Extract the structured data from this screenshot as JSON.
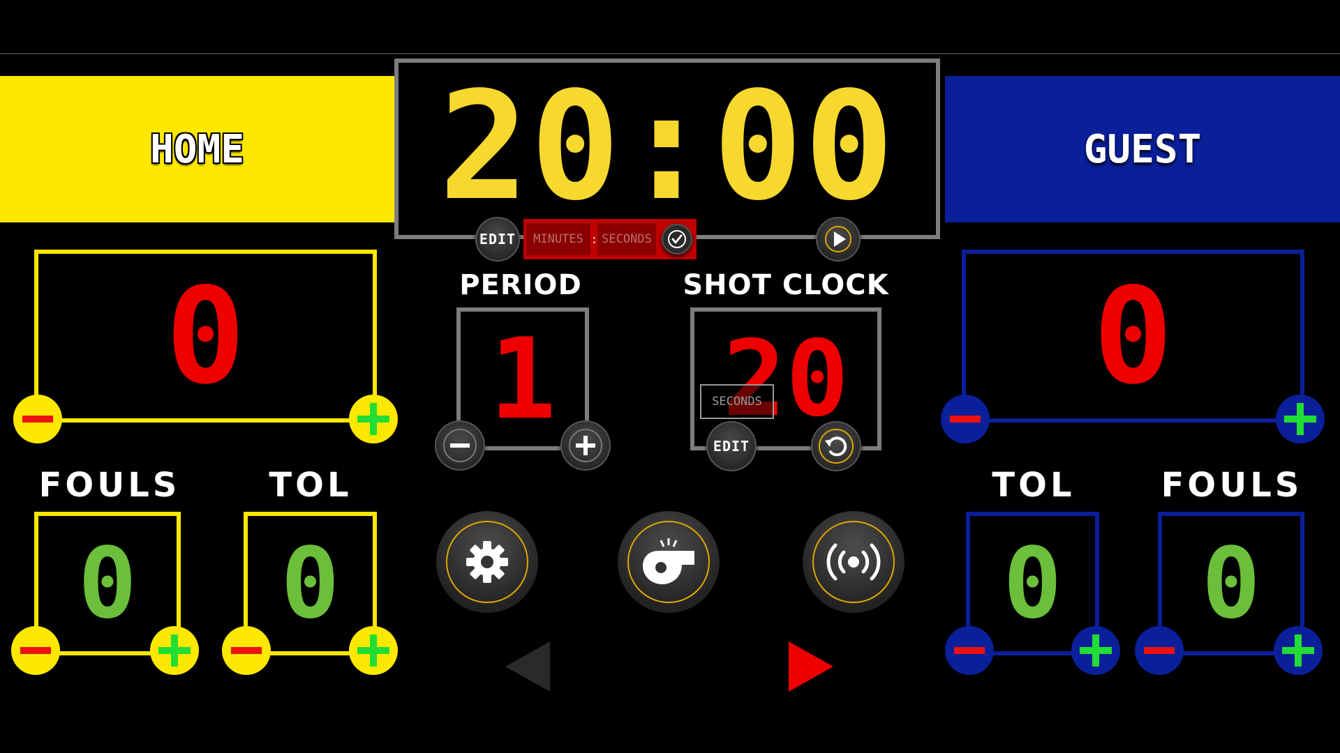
{
  "home": {
    "name": "HOME",
    "score": "0",
    "fouls_label": "FOULS",
    "fouls": "0",
    "tol_label": "TOL",
    "tol": "0"
  },
  "guest": {
    "name": "GUEST",
    "score": "0",
    "fouls_label": "FOULS",
    "fouls": "0",
    "tol_label": "TOL",
    "tol": "0"
  },
  "game_clock": {
    "time": "20:00",
    "edit_label": "EDIT",
    "minutes_placeholder": "MINUTES",
    "separator": ":",
    "seconds_placeholder": "SECONDS"
  },
  "period": {
    "label": "PERIOD",
    "value": "1"
  },
  "shot_clock": {
    "label": "SHOT CLOCK",
    "value": "20",
    "edit_label": "EDIT",
    "seconds_placeholder": "SECONDS"
  },
  "icons": {
    "settings": "gear-icon",
    "whistle": "whistle-icon",
    "broadcast": "broadcast-icon",
    "prev": "triangle-left-icon",
    "next": "triangle-right-icon"
  },
  "colors": {
    "home": "#FFE800",
    "guest": "#0A1F9A",
    "clock": "#F7D82E",
    "score": "#EE0000",
    "counter": "#6BBF3A",
    "plus": "#22DD33",
    "minus": "#EE1111",
    "accent_ring": "#E0A600",
    "possession_active": "#EE0000",
    "possession_inactive": "#2a2a2a"
  }
}
